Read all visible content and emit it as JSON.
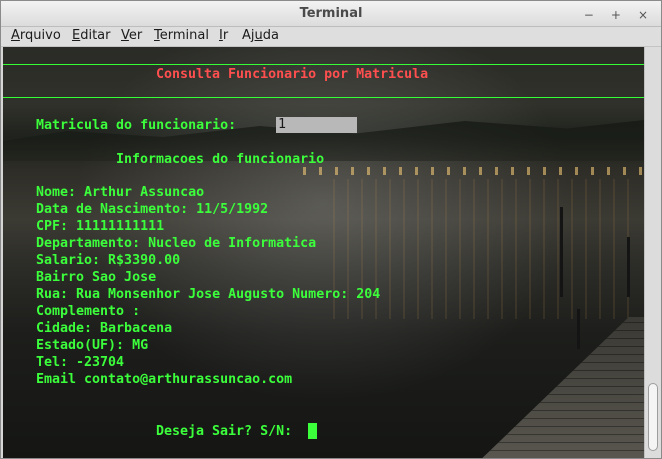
{
  "window": {
    "title": "Terminal",
    "controls": {
      "minimize": "−",
      "maximize": "+",
      "close": "×"
    }
  },
  "menu": {
    "items": [
      {
        "accel": "A",
        "rest": "rquivo"
      },
      {
        "accel": "E",
        "rest": "ditar"
      },
      {
        "accel": "V",
        "rest": "er"
      },
      {
        "accel": "T",
        "rest": "erminal"
      },
      {
        "accel": "I",
        "rest": "r"
      },
      {
        "pre": "Aj",
        "accel": "u",
        "rest": "da"
      }
    ]
  },
  "terminal": {
    "header": "Consulta Funcionario por Matricula",
    "matricula_label": "Matricula do funcionario:",
    "matricula_value": "1",
    "info_title": "Informacoes do funcionario",
    "lines": [
      "Nome: Arthur Assuncao",
      "Data de Nascimento: 11/5/1992",
      "CPF: 11111111111",
      "Departamento: Nucleo de Informatica",
      "Salario: R$3390.00",
      "Bairro Sao Jose",
      "Rua: Rua Monsenhor Jose Augusto Numero: 204",
      "Complemento :",
      "Cidade: Barbacena",
      "Estado(UF): MG",
      "Tel: -23704",
      "Email contato@arthurassuncao.com"
    ],
    "prompt": "Deseja Sair? S/N:",
    "text_color": "#3cff3c",
    "header_color": "#ff4f4f"
  }
}
